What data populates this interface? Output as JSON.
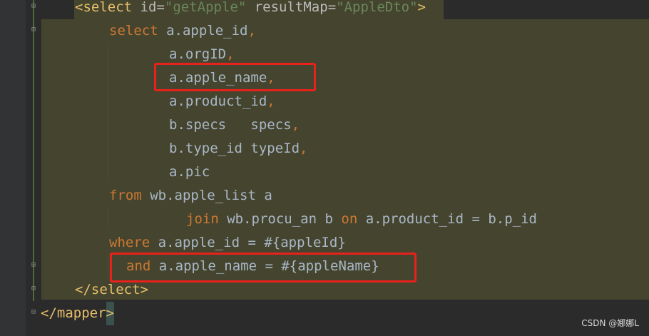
{
  "editor": {
    "code": {
      "select_open": {
        "lt": "<",
        "tag": "select",
        "id_attr": "id",
        "id_eq": "=",
        "id_val": "\"getApple\"",
        "rm_attr": "resultMap",
        "rm_eq": "=",
        "rm_val": "\"AppleDto\"",
        "gt": ">"
      },
      "l_select": {
        "kw": "select",
        "text": "a.apple_id",
        "comma": ","
      },
      "l_orgid": {
        "text": "a.orgID",
        "comma": ","
      },
      "l_apple_name": {
        "text": "a.apple_name",
        "comma": ","
      },
      "l_product_id": {
        "text": "a.product_id",
        "comma": ","
      },
      "l_specs": {
        "text": "b.specs   specs",
        "comma": ","
      },
      "l_type_id": {
        "text": "b.type_id typeId",
        "comma": ","
      },
      "l_pic": {
        "text": "a.pic"
      },
      "l_from": {
        "kw": "from",
        "text": "wb.apple_list a"
      },
      "l_join": {
        "kw1": "join",
        "text1": "wb.procu_an b",
        "kw2": "on",
        "text2": "a.product_id = b.p_id"
      },
      "l_where": {
        "kw": "where",
        "text": "a.apple_id = #{appleId}"
      },
      "l_and": {
        "kw": "and",
        "text": "a.apple_name = #{appleName}"
      },
      "select_close": {
        "text": "</select>"
      },
      "mapper_close": {
        "text": "</mapper",
        "bracket": ">"
      }
    }
  },
  "watermark": {
    "text": "CSDN @娜娜L"
  },
  "colors": {
    "background": "#2b2b2b",
    "block_highlight": "#45452f",
    "keyword": "#cc7832",
    "tag": "#e8bf6a",
    "string": "#6a8759",
    "text": "#a9b7c6",
    "annotation_box": "#e8211a"
  }
}
